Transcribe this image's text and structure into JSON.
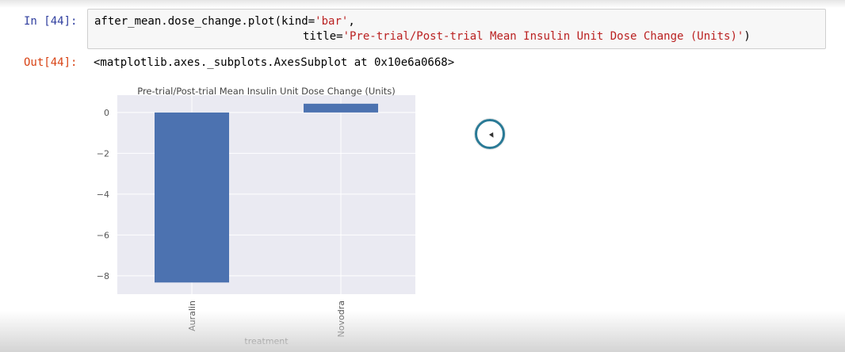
{
  "notebook": {
    "input_prompt": "In [44]:",
    "code_line1_prefix": "after_mean.dose_change.plot(kind=",
    "code_line1_str": "'bar'",
    "code_line1_suffix": ",",
    "code_line2_prefix": "title=",
    "code_line2_str": "'Pre-trial/Post-trial Mean Insulin Unit Dose Change (Units)'",
    "code_line2_suffix": ")",
    "output_prompt": "Out[44]:",
    "output_text": "<matplotlib.axes._subplots.AxesSubplot at 0x10e6a0668>"
  },
  "chart_data": {
    "type": "bar",
    "title": "Pre-trial/Post-trial Mean Insulin Unit Dose Change (Units)",
    "xlabel": "treatment",
    "ylabel": "",
    "categories": [
      "Auralin",
      "Novodra"
    ],
    "values": [
      -8.33,
      0.43
    ],
    "ylim": [
      -8.9,
      0.85
    ],
    "yticks": [
      0,
      -2,
      -4,
      -6,
      -8
    ],
    "ytick_labels": [
      "0",
      "−2",
      "−4",
      "−6",
      "−8"
    ],
    "grid": true,
    "bar_color": "#4c72b0",
    "background_color": "#eaeaf2"
  },
  "colors": {
    "input_prompt": "#303f9f",
    "output_prompt": "#d84315",
    "string": "#ba2121",
    "cursor": "#2a7a96"
  }
}
